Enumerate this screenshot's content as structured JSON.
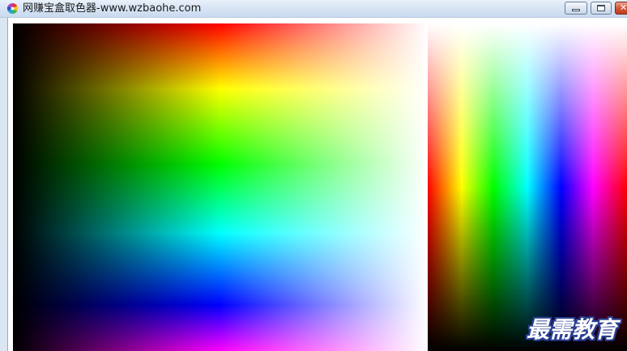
{
  "window": {
    "title": "网赚宝盒取色器-www.wzbaohe.com",
    "app_icon": "color-wheel-icon",
    "controls": {
      "minimize_icon": "minimize-icon",
      "maximize_icon": "maximize-icon",
      "close_icon": "close-icon",
      "close_glyph": "✕"
    }
  },
  "color_picker": {
    "main_spectrum": {
      "hue_order": [
        "#ff0000",
        "#ffff00",
        "#00ff00",
        "#00ffff",
        "#0000ff",
        "#ff00ff"
      ],
      "left_shade": "#000000",
      "right_tint": "#ffffff"
    },
    "side_spectrum": {
      "hue_order": [
        "#ff0000",
        "#ffff00",
        "#00ff00",
        "#00ffff",
        "#0000ff",
        "#ff00ff",
        "#ff0000"
      ],
      "top_tint": "#ffffff",
      "bottom_shade": "#000000"
    }
  },
  "watermark": {
    "text": "最需教育",
    "outline_color": "#2a3f8f"
  }
}
